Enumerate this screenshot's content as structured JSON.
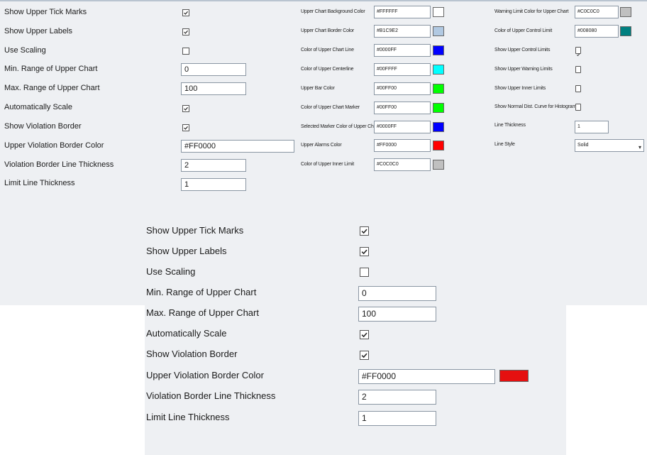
{
  "main": {
    "show_tick_marks": {
      "label": "Show Upper Tick Marks",
      "checked": true
    },
    "show_labels": {
      "label": "Show Upper Labels",
      "checked": true
    },
    "use_scaling": {
      "label": "Use Scaling",
      "checked": false
    },
    "min_range": {
      "label": "Min. Range of Upper Chart",
      "value": "0"
    },
    "max_range": {
      "label": "Max. Range of Upper Chart",
      "value": "100"
    },
    "auto_scale": {
      "label": "Automatically Scale",
      "checked": true
    },
    "show_violation_border": {
      "label": "Show Violation Border",
      "checked": true
    },
    "violation_border_color": {
      "label": "Upper Violation Border Color",
      "value": "#FF0000"
    },
    "violation_border_thickness": {
      "label": "Violation Border Line Thickness",
      "value": "2"
    },
    "limit_line_thickness": {
      "label": "Limit Line Thickness",
      "value": "1"
    }
  },
  "middle": [
    {
      "label": "Upper Chart Background Color",
      "value": "#FFFFFF",
      "color": "#FFFFFF"
    },
    {
      "label": "Upper Chart Border Color",
      "value": "#B1C9E2",
      "color": "#B1C9E2"
    },
    {
      "label": "Color of Upper Chart Line",
      "value": "#0000FF",
      "color": "#0000FF"
    },
    {
      "label": "Color of Upper Centerline",
      "value": "#00FFFF",
      "color": "#00FFFF"
    },
    {
      "label": "Upper Bar Color",
      "value": "#00FF00",
      "color": "#00FF00"
    },
    {
      "label": "Color of Upper Chart Marker",
      "value": "#00FF00",
      "color": "#00FF00"
    },
    {
      "label": "Selected Marker Color of Upper Chart",
      "value": "#0000FF",
      "color": "#0000FF"
    },
    {
      "label": "Upper Alarms Color",
      "value": "#FF0000",
      "color": "#FF0000"
    },
    {
      "label": "Color of Upper Inner Limit",
      "value": "#C0C0C0",
      "color": "#C0C0C0"
    }
  ],
  "right": {
    "warning_color": {
      "label": "Warning Limit Color for Upper Chart",
      "value": "#C0C0C0",
      "color": "#C0C0C0"
    },
    "control_color": {
      "label": "Color of Upper Control Limit",
      "value": "#008080",
      "color": "#008080"
    },
    "show_control_limits": {
      "label": "Show Upper Control Limits",
      "checked": true
    },
    "show_warning_limits": {
      "label": "Show Upper Warning Limits",
      "checked": false
    },
    "show_inner_limits": {
      "label": "Show Upper Inner Limits",
      "checked": false
    },
    "show_normal_curve": {
      "label": "Show Normal Dist. Curve for Histogram",
      "checked": false
    },
    "line_thickness": {
      "label": "Line Thickness",
      "value": "1"
    },
    "line_style": {
      "label": "Line Style",
      "value": "Solid"
    }
  },
  "zoom": {
    "show_tick_marks": {
      "label": "Show Upper Tick Marks",
      "checked": true
    },
    "show_labels": {
      "label": "Show Upper Labels",
      "checked": true
    },
    "use_scaling": {
      "label": "Use Scaling",
      "checked": false
    },
    "min_range": {
      "label": "Min. Range of Upper Chart",
      "value": "0"
    },
    "max_range": {
      "label": "Max. Range of Upper Chart",
      "value": "100"
    },
    "auto_scale": {
      "label": "Automatically Scale",
      "checked": true
    },
    "show_violation_border": {
      "label": "Show Violation Border",
      "checked": true
    },
    "violation_border_color": {
      "label": "Upper Violation Border Color",
      "value": "#FF0000",
      "color": "#E51010"
    },
    "violation_border_thickness": {
      "label": "Violation Border Line Thickness",
      "value": "2"
    },
    "limit_line_thickness": {
      "label": "Limit Line Thickness",
      "value": "1"
    }
  }
}
